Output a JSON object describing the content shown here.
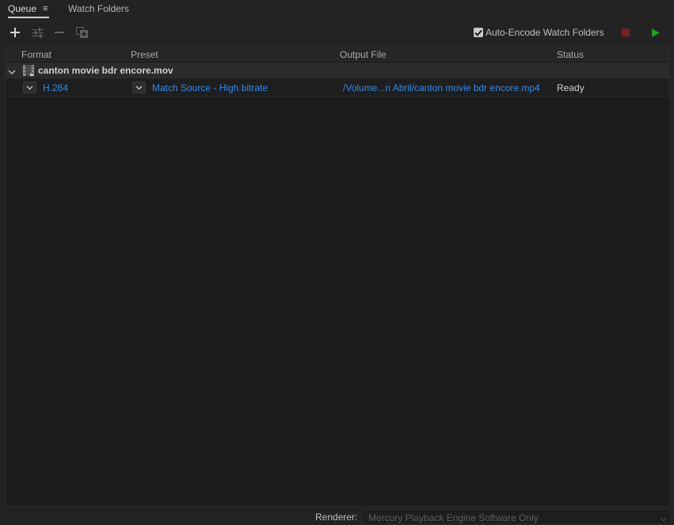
{
  "tabs": {
    "queue": "Queue",
    "queue_menu": "≡",
    "watch_folders": "Watch Folders"
  },
  "toolbar": {
    "add_icon": "plus-icon",
    "settings_icon": "sliders-icon",
    "remove_icon": "minus-icon",
    "duplicate_icon": "duplicate-icon",
    "auto_encode_label": "Auto-Encode Watch Folders",
    "auto_encode_checked": true,
    "stop_color": "#7a1f1f",
    "start_color": "#1fa01f"
  },
  "columns": {
    "format": "Format",
    "preset": "Preset",
    "output_file": "Output File",
    "status": "Status"
  },
  "queue": [
    {
      "source": "canton movie bdr encore.mov",
      "outputs": [
        {
          "format": "H.264",
          "preset": "Match Source - High bitrate",
          "output_file": "/Volume...n Abril/canton movie bdr encore.mp4",
          "status": "Ready"
        }
      ]
    }
  ],
  "footer": {
    "renderer_label": "Renderer:",
    "renderer_value": "Mercury Playback Engine Software Only"
  },
  "colors": {
    "link": "#2d8ceb",
    "background": "#232323"
  }
}
